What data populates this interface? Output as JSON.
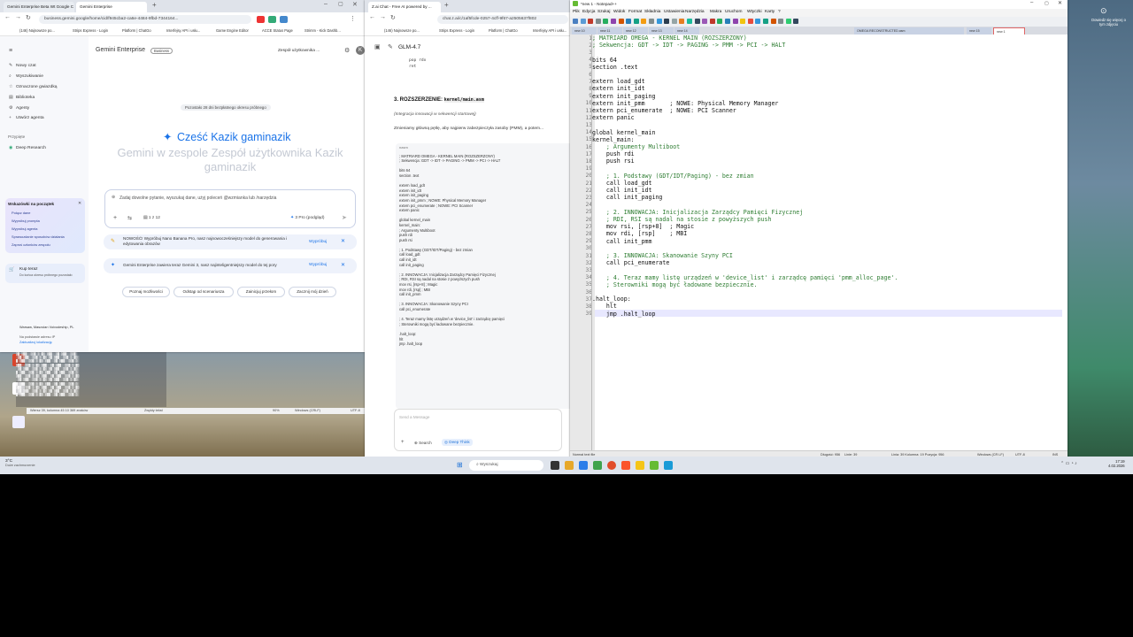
{
  "chrome": {
    "tabs": [
      "Gemini Enterprise Beta Wt Google C",
      "Gemini Enterprise"
    ],
    "url": "business.gemini.google/home/cid/f945cba2-ca6e-4484-9fbd-7344164...",
    "bookmarks": [
      "(146) Najnowsze po...",
      "Strips Express - Login",
      "Platform | ChatGo",
      "Interfejsy API i usłu...",
      "Game Engine Editor",
      "ACCE Status Page",
      "Strimm - Kick Dashb..."
    ]
  },
  "gemini": {
    "logo": "Gemini Enterprise",
    "badge": "Business",
    "team_select": "Zespół użytkownika ...",
    "sidebar_items": [
      "Nowy czat",
      "Wyszukiwanie",
      "Oznaczone gwiazdką",
      "Biblioteka",
      "Agenty",
      "Utwórz agenta"
    ],
    "section_label": "Przypięte",
    "pinned_item": "Deep Research",
    "tips_title": "Wskazówki na początek",
    "tips": [
      "Połącz dane",
      "Wypróbuj prompta",
      "Wypróbuj agenta",
      "Sprawozdanie sposobów działania",
      "Zaproś członków zespołu"
    ],
    "buy_title": "Kup teraz",
    "buy_sub": "Do końca okresu próbnego pozostało",
    "location": "Warsaw, Masovian Voivodeship, PL",
    "location_sub": "Na podstawie adresu IP",
    "update_location": "Zaktualizuj lokalizację",
    "trial": "Pozostało 28 dni bezpłatnego okresu próbnego",
    "greeting": "Cześć Kazik gaminazik",
    "subgreeting": "Gemini w zespole Zespół użytkownika Kazik gaminazik",
    "prompt_placeholder": "Zadaj dowolne pytanie, wyszukaj dane, użyj poleceń @wzmianka lub /narzędzia",
    "prompt_counter": "1 z 12",
    "model": "3 Pro (podgląd)",
    "banner1": "NOWOŚĆ! Wypróbuj Nano Banana Pro, nasz najnowocześniejszy model do generowania i edytowania obrazów",
    "banner2": "Gemini Enterprise zawiera teraz Gemini 3, nasz najinteligentniejszy model do tej pory",
    "try_label": "Wypróbuj",
    "chips": [
      "Poznaj możliwości",
      "Odstąp od scenariusza",
      "Zainicjuj przełom",
      "Zacznij mój dzień"
    ]
  },
  "zai": {
    "tab": "Z.ai Chat - Free AI powered by ...",
    "url": "chat.z.ai/c/1af5fcde-0257-4cff-9f67-a2505637f802",
    "bookmarks": [
      "(146) Najnowsze po...",
      "Strips Express - Login",
      "Platform | ChatGo",
      "Interfejsy API i usłu..."
    ],
    "model": "GLM-4.7",
    "top_code": [
      "pop rdx",
      "ret"
    ],
    "section_title": "3. ROZSZERZENIE:",
    "section_file": "kernel/main.asm",
    "section_note": "(Integracja innowacji w sekwencji startowej)",
    "section_desc": "Zmieniamy główną pętlę, aby najpierw zabezpieczyła zasoby (PMM), a potem...",
    "code_lang": "nasm",
    "code": [
      "; MATRIARD OMEGA - KERNEL MAIN (ROZSZERZONY)",
      "; Sekwencja: GDT -> IDT -> PAGING -> PMM -> PCI -> HALT",
      "",
      "bits 64",
      "section .text",
      "",
      "extern load_gdt",
      "extern init_idt",
      "extern init_paging",
      "extern init_pmm       ; NOWE: Physical Memory Manager",
      "extern pci_enumerate  ; NOWE: PCI Scanner",
      "extern panic",
      "",
      "global kernel_main",
      "kernel_main:",
      "    ; Argumenty Multiboot",
      "    push rdi",
      "    push rsi",
      "",
      "    ; 1. Podstawy (GDT/IDT/Paging) - bez zmian",
      "    call load_gdt",
      "    call init_idt",
      "    call init_paging",
      "",
      "    ; 2. INNOWACJA: Inicjalizacja Zarządcy Pamięci Fizycznej",
      "    ; RDI, RSI są nadal na stosie z powyższych push",
      "    mov rsi, [rsp+8]  ; Magic",
      "    mov rdi, [rsp]    ; MBI",
      "    call init_pmm",
      "",
      "    ; 3. INNOWACJA: Skanowanie Szyny PCI",
      "    call pci_enumerate",
      "",
      "    ; 4. Teraz mamy listę urządzeń w 'device_list' i zarządcę pamięci",
      "    ; Sterowniki mogą być ładowane bezpiecznie.",
      "",
      ".halt_loop:",
      "    hlt",
      "    jmp .halt_loop"
    ],
    "input_placeholder": "Send a Message",
    "search_btn": "Search",
    "think_btn": "Deep Think"
  },
  "notepad": {
    "title": "*new 1 - Notepad++",
    "menu": [
      "Plik",
      "Edycja",
      "Szukaj",
      "Widok",
      "Format",
      "Składnia",
      "Ustawienia",
      "Narzędzia",
      "Makra",
      "Uruchom",
      "Wtyczki",
      "Karty",
      "?"
    ],
    "tabs": [
      "new 10",
      "new 11",
      "new 12",
      "new 13",
      "new 14",
      "OMEGA RECONSTRUCTED.asm",
      "new 15",
      "new 1"
    ],
    "lines": [
      "; MATRIARD OMEGA - KERNEL MAIN (ROZSZERZONY)",
      "; Sekwencja: GDT -> IDT -> PAGING -> PMM -> PCI -> HALT",
      "",
      "bits 64",
      "section .text",
      "",
      "extern load_gdt",
      "extern init_idt",
      "extern init_paging",
      "extern init_pmm       ; NOWE: Physical Memory Manager",
      "extern pci_enumerate  ; NOWE: PCI Scanner",
      "extern panic",
      "",
      "global kernel_main",
      "kernel_main:",
      "    ; Argumenty Multiboot",
      "    push rdi",
      "    push rsi",
      "",
      "    ; 1. Podstawy (GDT/IDT/Paging) - bez zmian",
      "    call load_gdt",
      "    call init_idt",
      "    call init_paging",
      "",
      "    ; 2. INNOWACJA: Inicjalizacja Zarządcy Pamięci Fizycznej",
      "    ; RDI, RSI są nadal na stosie z powyższych push",
      "    mov rsi, [rsp+8]  ; Magic",
      "    mov rdi, [rsp]    ; MBI",
      "    call init_pmm",
      "",
      "    ; 3. INNOWACJA: Skanowanie Szyny PCI",
      "    call pci_enumerate",
      "",
      "    ; 4. Teraz mamy listę urządzeń w 'device_list' i zarządcę pamięci 'pmm_alloc_page'.",
      "    ; Sterowniki mogą być ładowane bezpiecznie.",
      "",
      ".halt_loop:",
      "    hlt",
      "    jmp .halt_loop"
    ],
    "status_type": "Normal text file",
    "status_length": "Długość: 956",
    "status_lines": "Linie: 39",
    "status_pos": "Linia: 39   Kolumna: 19   Pozycja: 956",
    "status_eol": "Windows (CR LF)",
    "status_enc": "UTF-8",
    "status_ins": "INS"
  },
  "desktop": {
    "watermark": "Dowiedz się więcej o tym zdjęciu",
    "bg_status": "Wiersz 39, kolumna 45     10 369 znaków",
    "bg_status2": "Zwykły tekst",
    "bg_zoom": "90%",
    "bg_eol": "Windows (CRLF)",
    "bg_enc": "UTF-8"
  },
  "taskbar": {
    "weather_temp": "3°C",
    "weather_desc": "Duże zachmurzenie",
    "search": "Wyszukaj",
    "time": "17:19",
    "date": "4.02.2026"
  }
}
